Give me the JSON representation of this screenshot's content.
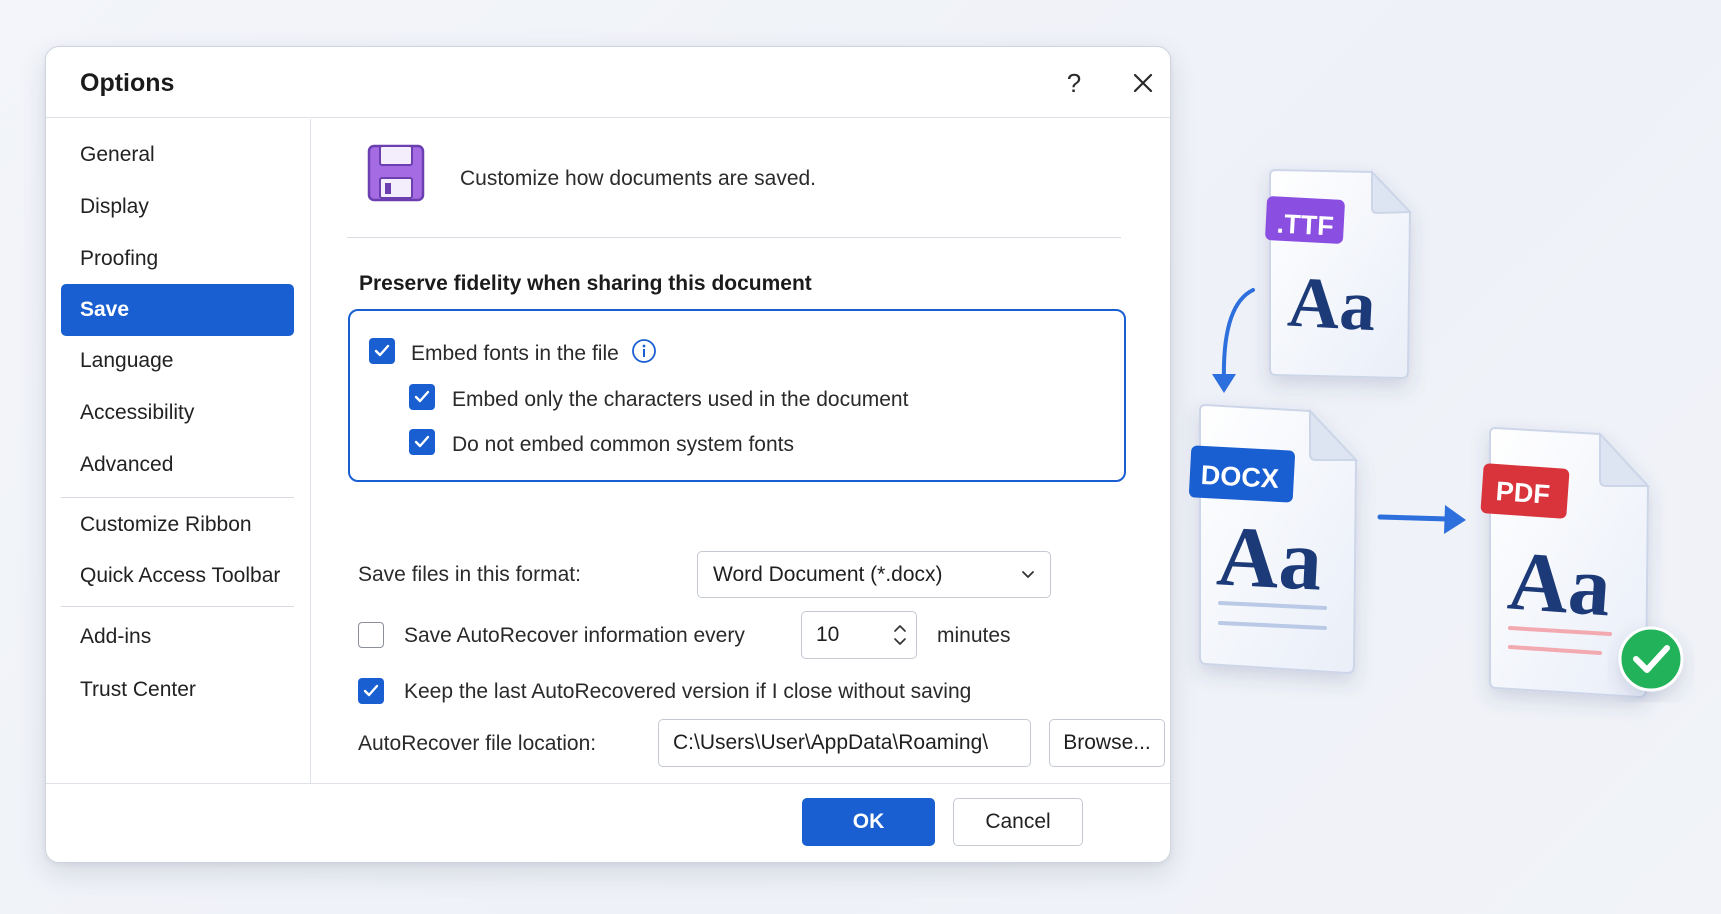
{
  "dialog": {
    "title": "Options",
    "help_label": "?"
  },
  "sidebar": {
    "items": [
      {
        "label": "General"
      },
      {
        "label": "Display"
      },
      {
        "label": "Proofing"
      },
      {
        "label": "Save",
        "active": true
      },
      {
        "label": "Language"
      },
      {
        "label": "Accessibility"
      },
      {
        "label": "Advanced"
      },
      {
        "label": "Customize Ribbon"
      },
      {
        "label": "Quick Access Toolbar"
      },
      {
        "label": "Add-ins"
      },
      {
        "label": "Trust Center"
      }
    ]
  },
  "main": {
    "description": "Customize how documents are saved.",
    "fidelity_section": {
      "title": "Preserve fidelity when sharing this document",
      "embed_fonts": {
        "label": "Embed fonts in the file",
        "checked": true
      },
      "embed_only_used": {
        "label": "Embed only the characters used in the document",
        "checked": true
      },
      "no_common_fonts": {
        "label": "Do not embed common system fonts",
        "checked": true
      }
    },
    "save_format": {
      "label": "Save files in this format:",
      "value": "Word Document (*.docx)"
    },
    "autorecover": {
      "label": "Save AutoRecover information every",
      "checked": false,
      "minutes_value": "10",
      "unit_label": "minutes"
    },
    "keep_last": {
      "label": "Keep the last AutoRecovered version if I close without saving",
      "checked": true
    },
    "location": {
      "label": "AutoRecover file location:",
      "value": "C:\\Users\\User\\AppData\\Roaming\\",
      "browse_label": "Browse..."
    }
  },
  "footer": {
    "ok_label": "OK",
    "cancel_label": "Cancel"
  },
  "illustration": {
    "ttf_badge": ".TTF",
    "docx_badge": "DOCX",
    "pdf_badge": "PDF",
    "glyph_text": "Aa",
    "colors": {
      "ttf": "#8a4fe0",
      "docx": "#1a5fd1",
      "pdf": "#d9343b",
      "check": "#22b35a",
      "accent": "#1a5fd1"
    }
  }
}
